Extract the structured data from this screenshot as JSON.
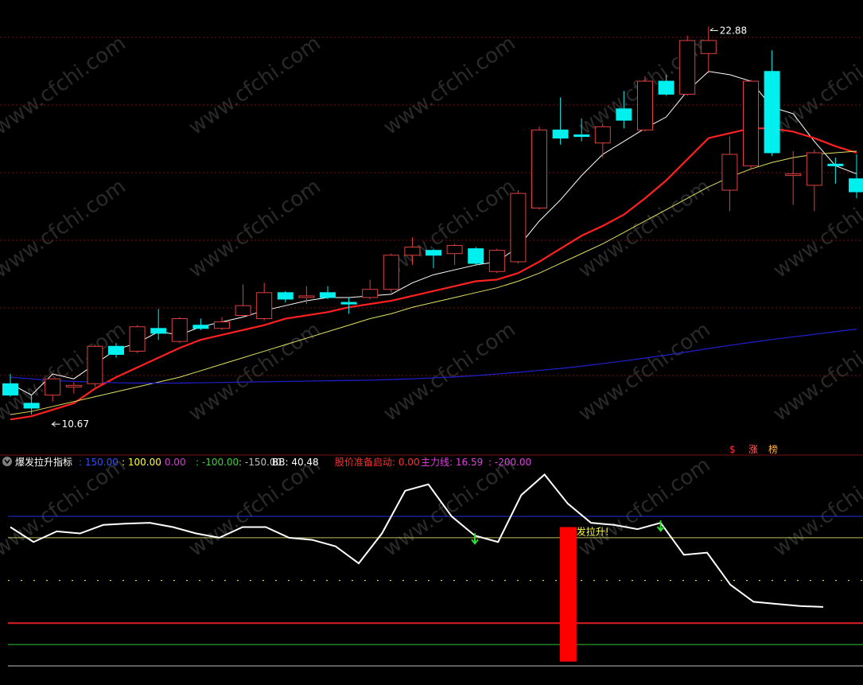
{
  "watermark": "www.cfchi.com",
  "colors": {
    "up": "#e04040",
    "down": "#00f0f0",
    "ma5": "#ffffff",
    "ma10": "#ff2020",
    "ma20": "#e0e060",
    "ma60": "#2020d0",
    "grid": "#7a1010",
    "indicator": "#ffffff",
    "bar": "#ff0000"
  },
  "price_panel": {
    "high_label": "22.88",
    "low_label": "10.67",
    "badges": [
      "$",
      "涨",
      "榜"
    ]
  },
  "indicator_panel": {
    "title": "爆发拉升指标",
    "legend": [
      {
        "text": ": 150.00",
        "color": "#3050ff"
      },
      {
        "text": ": 100.00",
        "color": "#ffff40"
      },
      {
        "text": ": 0.00",
        "color": "#d040d0"
      },
      {
        "text": ": -100.00",
        "color": "#40d040"
      },
      {
        "text": ": -150.00",
        "color": "#c0c0c0"
      },
      {
        "text": "BB: 40.48",
        "color": "#ffffff"
      },
      {
        "text": "股价准备启动: 0.00",
        "color": "#ff3030"
      },
      {
        "text": "主力线: 16.59",
        "color": "#e040e0"
      },
      {
        "text": ": -200.00",
        "color": "#e040e0"
      }
    ],
    "signal_text": "发拉升!"
  },
  "chart_data": [
    {
      "type": "candlestick",
      "title": "",
      "ylim": [
        10.0,
        23.5
      ],
      "candles": [
        {
          "o": 11.9,
          "h": 12.2,
          "l": 11.5,
          "c": 11.55
        },
        {
          "o": 11.3,
          "h": 11.55,
          "l": 10.95,
          "c": 11.15
        },
        {
          "o": 11.55,
          "h": 12.05,
          "l": 11.35,
          "c": 12.05
        },
        {
          "o": 11.8,
          "h": 11.95,
          "l": 11.6,
          "c": 11.85
        },
        {
          "o": 11.9,
          "h": 13.1,
          "l": 11.8,
          "c": 13.05
        },
        {
          "o": 13.05,
          "h": 13.15,
          "l": 12.7,
          "c": 12.8
        },
        {
          "o": 12.9,
          "h": 13.7,
          "l": 12.85,
          "c": 13.65
        },
        {
          "o": 13.6,
          "h": 14.2,
          "l": 13.25,
          "c": 13.45
        },
        {
          "o": 13.2,
          "h": 13.95,
          "l": 13.15,
          "c": 13.9
        },
        {
          "o": 13.7,
          "h": 13.9,
          "l": 13.55,
          "c": 13.6
        },
        {
          "o": 13.6,
          "h": 13.95,
          "l": 13.55,
          "c": 13.8
        },
        {
          "o": 14.0,
          "h": 14.95,
          "l": 13.95,
          "c": 14.3
        },
        {
          "o": 13.9,
          "h": 15.0,
          "l": 13.85,
          "c": 14.7
        },
        {
          "o": 14.7,
          "h": 14.75,
          "l": 14.4,
          "c": 14.5
        },
        {
          "o": 14.55,
          "h": 14.9,
          "l": 14.35,
          "c": 14.6
        },
        {
          "o": 14.7,
          "h": 14.9,
          "l": 14.5,
          "c": 14.55
        },
        {
          "o": 14.4,
          "h": 14.55,
          "l": 14.05,
          "c": 14.35
        },
        {
          "o": 14.55,
          "h": 15.1,
          "l": 14.5,
          "c": 14.8
        },
        {
          "o": 14.8,
          "h": 15.9,
          "l": 14.7,
          "c": 15.85
        },
        {
          "o": 15.85,
          "h": 16.4,
          "l": 15.55,
          "c": 16.1
        },
        {
          "o": 16.0,
          "h": 16.05,
          "l": 15.45,
          "c": 15.85
        },
        {
          "o": 15.9,
          "h": 16.2,
          "l": 15.55,
          "c": 16.15
        },
        {
          "o": 16.05,
          "h": 16.1,
          "l": 15.55,
          "c": 15.6
        },
        {
          "o": 15.35,
          "h": 16.05,
          "l": 15.3,
          "c": 16.0
        },
        {
          "o": 15.65,
          "h": 17.85,
          "l": 15.6,
          "c": 17.75
        },
        {
          "o": 17.3,
          "h": 19.8,
          "l": 17.25,
          "c": 19.7
        },
        {
          "o": 19.7,
          "h": 20.7,
          "l": 19.25,
          "c": 19.45
        },
        {
          "o": 19.55,
          "h": 20.05,
          "l": 19.35,
          "c": 19.5
        },
        {
          "o": 19.3,
          "h": 19.9,
          "l": 18.85,
          "c": 19.8
        },
        {
          "o": 20.35,
          "h": 20.9,
          "l": 19.75,
          "c": 20.0
        },
        {
          "o": 19.7,
          "h": 21.35,
          "l": 19.65,
          "c": 21.2
        },
        {
          "o": 21.2,
          "h": 21.4,
          "l": 20.75,
          "c": 20.8
        },
        {
          "o": 20.8,
          "h": 22.6,
          "l": 20.75,
          "c": 22.45
        },
        {
          "o": 22.05,
          "h": 22.88,
          "l": 21.45,
          "c": 22.45
        },
        {
          "o": 17.85,
          "h": 19.5,
          "l": 17.2,
          "c": 18.95
        },
        {
          "o": 18.6,
          "h": 21.25,
          "l": 18.5,
          "c": 21.2
        },
        {
          "o": 21.5,
          "h": 22.15,
          "l": 18.9,
          "c": 19.0
        },
        {
          "o": 18.3,
          "h": 19.05,
          "l": 17.4,
          "c": 18.35
        },
        {
          "o": 18.0,
          "h": 19.1,
          "l": 17.2,
          "c": 19.0
        },
        {
          "o": 18.65,
          "h": 18.85,
          "l": 18.05,
          "c": 18.6
        },
        {
          "o": 18.2,
          "h": 18.95,
          "l": 17.6,
          "c": 17.8
        }
      ],
      "series": [
        {
          "name": "MA5",
          "values": [
            11.9,
            11.55,
            12.2,
            12.05,
            12.5,
            12.95,
            13.15,
            13.5,
            13.4,
            13.65,
            13.8,
            13.95,
            14.15,
            14.3,
            14.45,
            14.55,
            14.55,
            14.6,
            14.65,
            15.0,
            15.25,
            15.4,
            15.55,
            15.65,
            16.1,
            16.9,
            17.55,
            18.3,
            18.95,
            19.35,
            19.75,
            20.1,
            20.9,
            21.5,
            21.4,
            21.2,
            20.4,
            20.2,
            19.35,
            18.6,
            18.35
          ]
        },
        {
          "name": "MA10",
          "values": [
            10.8,
            10.9,
            11.1,
            11.3,
            11.75,
            12.1,
            12.4,
            12.7,
            13.0,
            13.25,
            13.4,
            13.55,
            13.7,
            13.9,
            14.0,
            14.1,
            14.25,
            14.35,
            14.45,
            14.6,
            14.75,
            14.9,
            15.05,
            15.1,
            15.3,
            15.65,
            16.05,
            16.45,
            16.75,
            17.1,
            17.6,
            18.15,
            18.8,
            19.45,
            19.6,
            19.75,
            19.75,
            19.65,
            19.45,
            19.2,
            19.0
          ]
        },
        {
          "name": "MA20",
          "values": [
            10.95,
            11.05,
            11.2,
            11.35,
            11.5,
            11.65,
            11.8,
            11.95,
            12.1,
            12.3,
            12.5,
            12.7,
            12.9,
            13.1,
            13.3,
            13.5,
            13.7,
            13.9,
            14.05,
            14.25,
            14.4,
            14.55,
            14.7,
            14.85,
            15.05,
            15.3,
            15.6,
            15.9,
            16.2,
            16.55,
            16.9,
            17.25,
            17.6,
            17.95,
            18.25,
            18.5,
            18.7,
            18.85,
            18.95,
            19.0,
            19.05
          ]
        },
        {
          "name": "MA60",
          "values": [
            12.1,
            12.05,
            12.0,
            11.97,
            11.95,
            11.93,
            11.92,
            11.92,
            11.92,
            11.93,
            11.94,
            11.95,
            11.96,
            11.97,
            11.98,
            11.99,
            12.0,
            12.01,
            12.03,
            12.05,
            12.08,
            12.11,
            12.15,
            12.2,
            12.25,
            12.31,
            12.37,
            12.44,
            12.52,
            12.6,
            12.69,
            12.78,
            12.88,
            12.98,
            13.08,
            13.17,
            13.26,
            13.34,
            13.42,
            13.5,
            13.58
          ]
        }
      ]
    },
    {
      "type": "line",
      "title": "爆发拉升指标",
      "ylim": [
        -215,
        260
      ],
      "reference_lines": [
        150,
        100,
        0,
        -100,
        -150,
        -200
      ],
      "series": [
        {
          "name": "BB",
          "values": [
            125,
            90,
            115,
            110,
            130,
            133,
            135,
            125,
            110,
            100,
            125,
            125,
            100,
            95,
            80,
            40,
            110,
            210,
            225,
            150,
            105,
            90,
            200,
            248,
            180,
            135,
            130,
            120,
            135,
            60,
            65,
            -10,
            -50,
            -55,
            -60,
            -62
          ]
        }
      ],
      "bars": [
        {
          "index": 24,
          "from": -190,
          "to": 125,
          "label": "发拉升!"
        }
      ],
      "arrows": [
        {
          "index": 20
        },
        {
          "index": 28
        }
      ]
    }
  ]
}
